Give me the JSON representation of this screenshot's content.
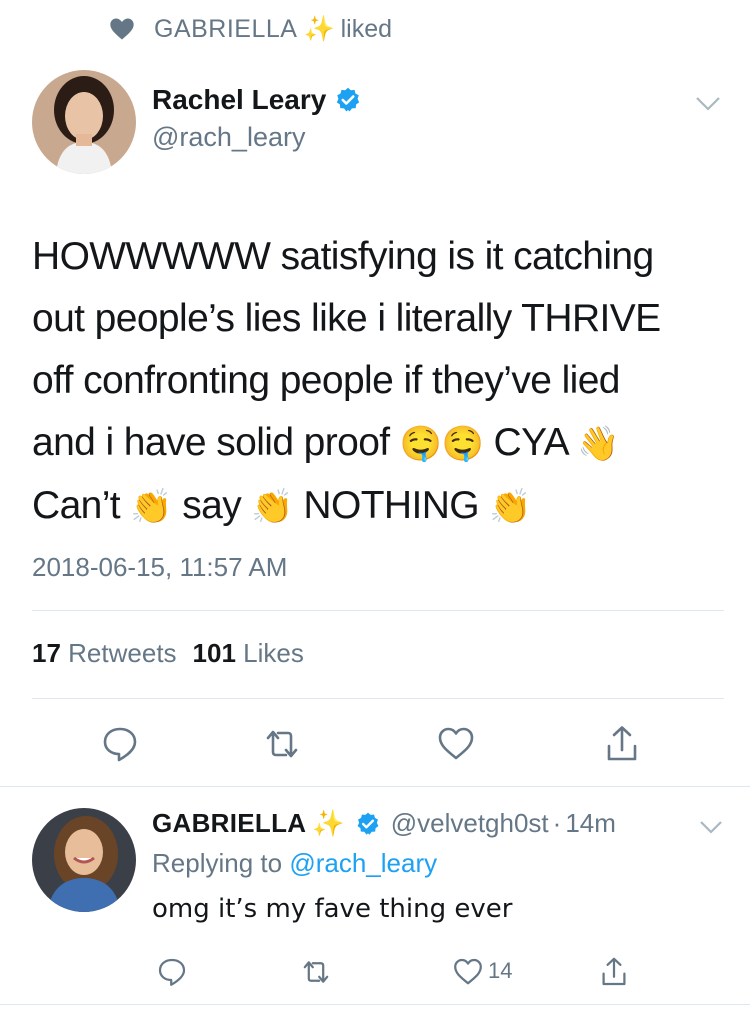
{
  "social_context": {
    "name": "GABRIELLA",
    "sparkle": "✨",
    "action": "liked"
  },
  "tweet": {
    "author_name": "Rachel Leary",
    "author_handle": "@rach_leary",
    "text_lines": [
      "HOWWWWW satisfying is it catching",
      "out people’s lies like i literally THRIVE",
      "off confronting people if they’ve lied"
    ],
    "line4_text": "and i have solid proof",
    "line4_emoji": "🤤🤤",
    "line4_end": "CYA",
    "wave_emoji": "👋",
    "line5_a": "Can’t",
    "line5_b": "say",
    "line5_c": "NOTHING",
    "clap_emoji": "👏",
    "timestamp": "2018-06-15, 11:57 AM",
    "retweet_count": "17",
    "retweet_label": "Retweets",
    "like_count": "101",
    "like_label": "Likes",
    "icons": [
      "reply-icon",
      "retweet-icon",
      "like-icon",
      "share-icon"
    ]
  },
  "reply": {
    "author_name": "GABRIELLA",
    "sparkle": "✨",
    "author_handle": "@velvetgh0st",
    "separator": "·",
    "time": "14m",
    "replying_prefix": "Replying to",
    "replying_to": "@rach_leary",
    "text": "omg it’s my fave thing ever",
    "like_count": "14"
  },
  "colors": {
    "text": "#14171a",
    "secondary": "#657786",
    "link": "#1da1f2",
    "divider": "#e1e8ed"
  }
}
